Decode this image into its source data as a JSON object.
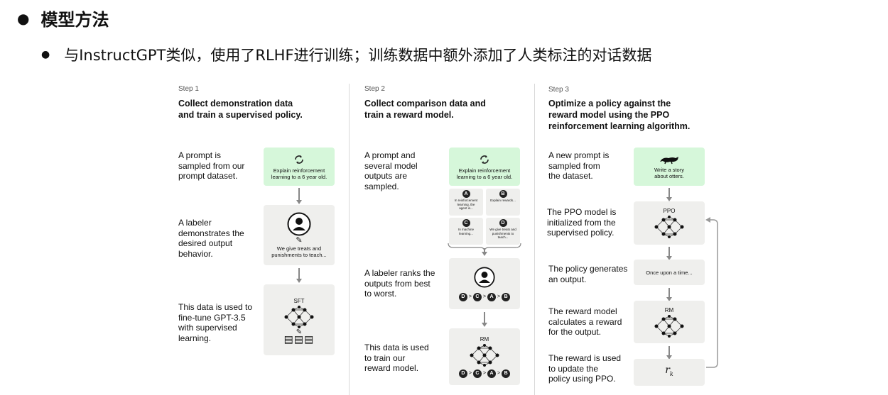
{
  "heading": "模型方法",
  "subheading": "与InstructGPT类似，使用了RLHF进行训练；训练数据中额外添加了人类标注的对话数据",
  "steps": [
    {
      "label": "Step 1",
      "title": "Collect demonstration data\nand train a supervised policy.",
      "descs": [
        "A prompt is\nsampled from our\nprompt dataset.",
        "A labeler\ndemonstrates the\ndesired output\nbehavior.",
        "This data is used to\nfine-tune GPT-3.5\nwith supervised\nlearning."
      ],
      "prompt_card": "Explain reinforcement\nlearning to a 6 year old.",
      "labeler_card": "We give treats and\npunishments to teach...",
      "model_label": "SFT"
    },
    {
      "label": "Step 2",
      "title": "Collect comparison data and\ntrain a reward model.",
      "descs": [
        "A prompt and\nseveral model\noutputs are\nsampled.",
        "A labeler ranks the\noutputs from best\nto worst.",
        "This data is used\nto train our\nreward model."
      ],
      "prompt_card": "Explain reinforcement\nlearning to a 6 year old.",
      "outputs": [
        {
          "letter": "A",
          "text": "In reinforcement\nlearning, the\nagent is..."
        },
        {
          "letter": "B",
          "text": "Explain rewards..."
        },
        {
          "letter": "C",
          "text": "In machine\nlearning..."
        },
        {
          "letter": "D",
          "text": "We give treats and\npunishments to\nteach..."
        }
      ],
      "ranking": [
        "D",
        "C",
        "A",
        "B"
      ],
      "model_label": "RM"
    },
    {
      "label": "Step 3",
      "title": "Optimize a policy against the\nreward model using the PPO\nreinforcement learning algorithm.",
      "descs": [
        "A new prompt is\nsampled from\nthe dataset.",
        "The PPO model is\ninitialized from the\nsupervised policy.",
        "The policy generates\nan output.",
        "The reward model\ncalculates a reward\nfor the output.",
        "The reward is used\nto update the\npolicy using PPO."
      ],
      "prompt_card": "Write a story\nabout otters.",
      "ppo_label": "PPO",
      "output_card": "Once upon a time...",
      "rm_label": "RM",
      "reward_symbol": "r",
      "reward_sub": "k"
    }
  ]
}
